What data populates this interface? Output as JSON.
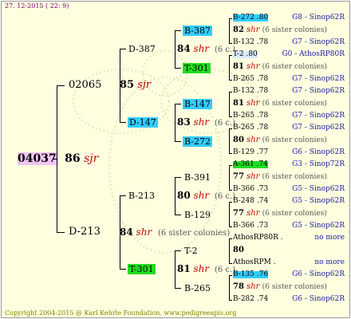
{
  "header": {
    "date": "27. 12-2015 ( 22: 9)"
  },
  "footer": {
    "copyright": "Copyright 2004-2015 @ Karl Kehrle Foundation.   www.pedigreeapis.org"
  },
  "root": {
    "id": "04037",
    "year": "86",
    "tag": "sjr"
  },
  "gen1": [
    {
      "id": "02065"
    },
    {
      "id": "D-213"
    }
  ],
  "gen1_years": [
    {
      "year": "85",
      "tag": "sjr"
    },
    {
      "year": "84",
      "tag": "shr",
      "note": "(6 sister colonies)"
    }
  ],
  "gen2": [
    {
      "id": "D-387"
    },
    {
      "id": "D-147"
    },
    {
      "id": "B-213"
    },
    {
      "id": "T-301"
    }
  ],
  "gen2_years": [
    {
      "year": "84",
      "tag": "shr",
      "note": "(6 c.)"
    },
    {
      "year": "83",
      "tag": "shr",
      "note": "(6 c.)"
    },
    {
      "year": "80",
      "tag": "shr",
      "note": "(6 c.)"
    },
    {
      "year": "81",
      "tag": "shr",
      "note": "(6 c.)"
    }
  ],
  "gen3": [
    "B-387",
    "T-301",
    "B-147",
    "B-272",
    "B-391",
    "B-129",
    "T-2",
    "B-265"
  ],
  "gen4": [
    {
      "top": "B-272 .80",
      "top_right": "G8 - Sinop62R",
      "mid_year": "82",
      "mid_tag": "shr",
      "mid_note": "(6 sister colonies)",
      "bottom": "B-132 .78",
      "bottom_right": "G7 - Sinop62R"
    },
    {
      "top": "T-2 .80",
      "top_right": "G0 - AthosRP80R",
      "mid_year": "81",
      "mid_tag": "shr",
      "mid_note": "(6 sister colonies)",
      "bottom": "B-265 .78",
      "bottom_right": "G7 - Sinop62R"
    },
    {
      "top": "B-132 .78",
      "top_right": "G7 - Sinop62R",
      "mid_year": "81",
      "mid_tag": "shr",
      "mid_note": "(6 sister colonies)",
      "bottom": "B-265 .78",
      "bottom_right": "G7 - Sinop62R"
    },
    {
      "top": "B-265 .78",
      "top_right": "G7 - Sinop62R",
      "mid_year": "80",
      "mid_tag": "shr",
      "mid_note": "(6 sister colonies)",
      "bottom": "B-129 .77",
      "bottom_right": "G6 - Sinop62R"
    },
    {
      "top": "A-361 .74",
      "top_right": "G3 - Sinop72R",
      "mid_year": "77",
      "mid_tag": "shr",
      "mid_note": "(6 sister colonies)",
      "bottom": "B-366 .73",
      "bottom_right": "G5 - Sinop62R"
    },
    {
      "top": "B-248 .74",
      "top_right": "G5 - Sinop62R",
      "mid_year": "77",
      "mid_tag": "shr",
      "mid_note": "(6 sister colonies)",
      "bottom": "B-366 .73",
      "bottom_right": "G5 - Sinop62R"
    },
    {
      "top": "AthosRP80R .",
      "top_right": "no more",
      "mid_year": "80",
      "mid_tag": "",
      "mid_note": "",
      "bottom": "AthosRPM .",
      "bottom_right": "no more"
    },
    {
      "top": "B-135 .76",
      "top_right": "G6 - Sinop62R",
      "mid_year": "78",
      "mid_tag": "shr",
      "mid_note": "(6 sister colonies)",
      "bottom": "B-282 .74",
      "bottom_right": "G6 - Sinop62R"
    }
  ]
}
